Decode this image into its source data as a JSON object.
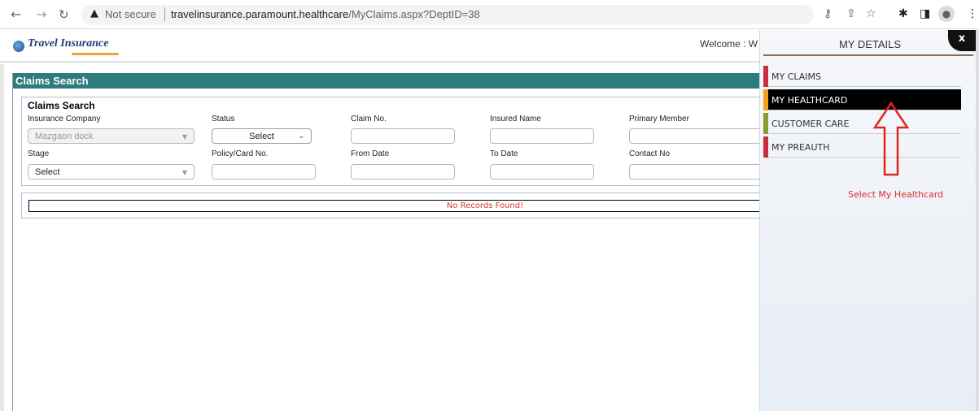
{
  "browser": {
    "back_icon": "back-arrow-icon",
    "forward_icon": "forward-arrow-icon",
    "reload_icon": "reload-icon",
    "security_warning": "Not secure",
    "url_host": "travelinsurance.paramount.healthcare",
    "url_path": "/MyClaims.aspx?DeptID=38",
    "toolbar_icons": [
      "key-icon",
      "share-icon",
      "star-icon",
      "extensions-icon",
      "sidepanel-icon",
      "profile-icon",
      "menu-icon"
    ]
  },
  "header": {
    "logo_text": "Travel Insurance",
    "welcome": "Welcome : W"
  },
  "main": {
    "panel_title": "Claims Search",
    "fieldset_title": "Claims Search",
    "labels": {
      "insurance_company": "Insurance Company",
      "status": "Status",
      "claim_no": "Claim No.",
      "insured_name": "Insured Name",
      "primary_member": "Primary Member",
      "stage": "Stage",
      "policy_card_no": "Policy/Card No.",
      "from_date": "From Date",
      "to_date": "To Date",
      "contact_no": "Contact No"
    },
    "insurance_company_value": "Mazgaon dock",
    "status_value": "Select",
    "stage_value": "Select",
    "no_records": "No Records Found!"
  },
  "drawer": {
    "title": "MY DETAILS",
    "close_label": "x",
    "items": [
      {
        "label": "MY CLAIMS",
        "color": "#c62f3b"
      },
      {
        "label": "MY HEALTHCARD",
        "color": "#f0a21e"
      },
      {
        "label": "CUSTOMER CARE",
        "color": "#8c9a2e"
      },
      {
        "label": "MY PREAUTH",
        "color": "#c62f3b"
      }
    ],
    "annotation": "Select My Healthcard"
  },
  "colors": {
    "panel_header": "#2d7b7e",
    "accent_red": "#d9302a",
    "active_item": "#000000"
  }
}
